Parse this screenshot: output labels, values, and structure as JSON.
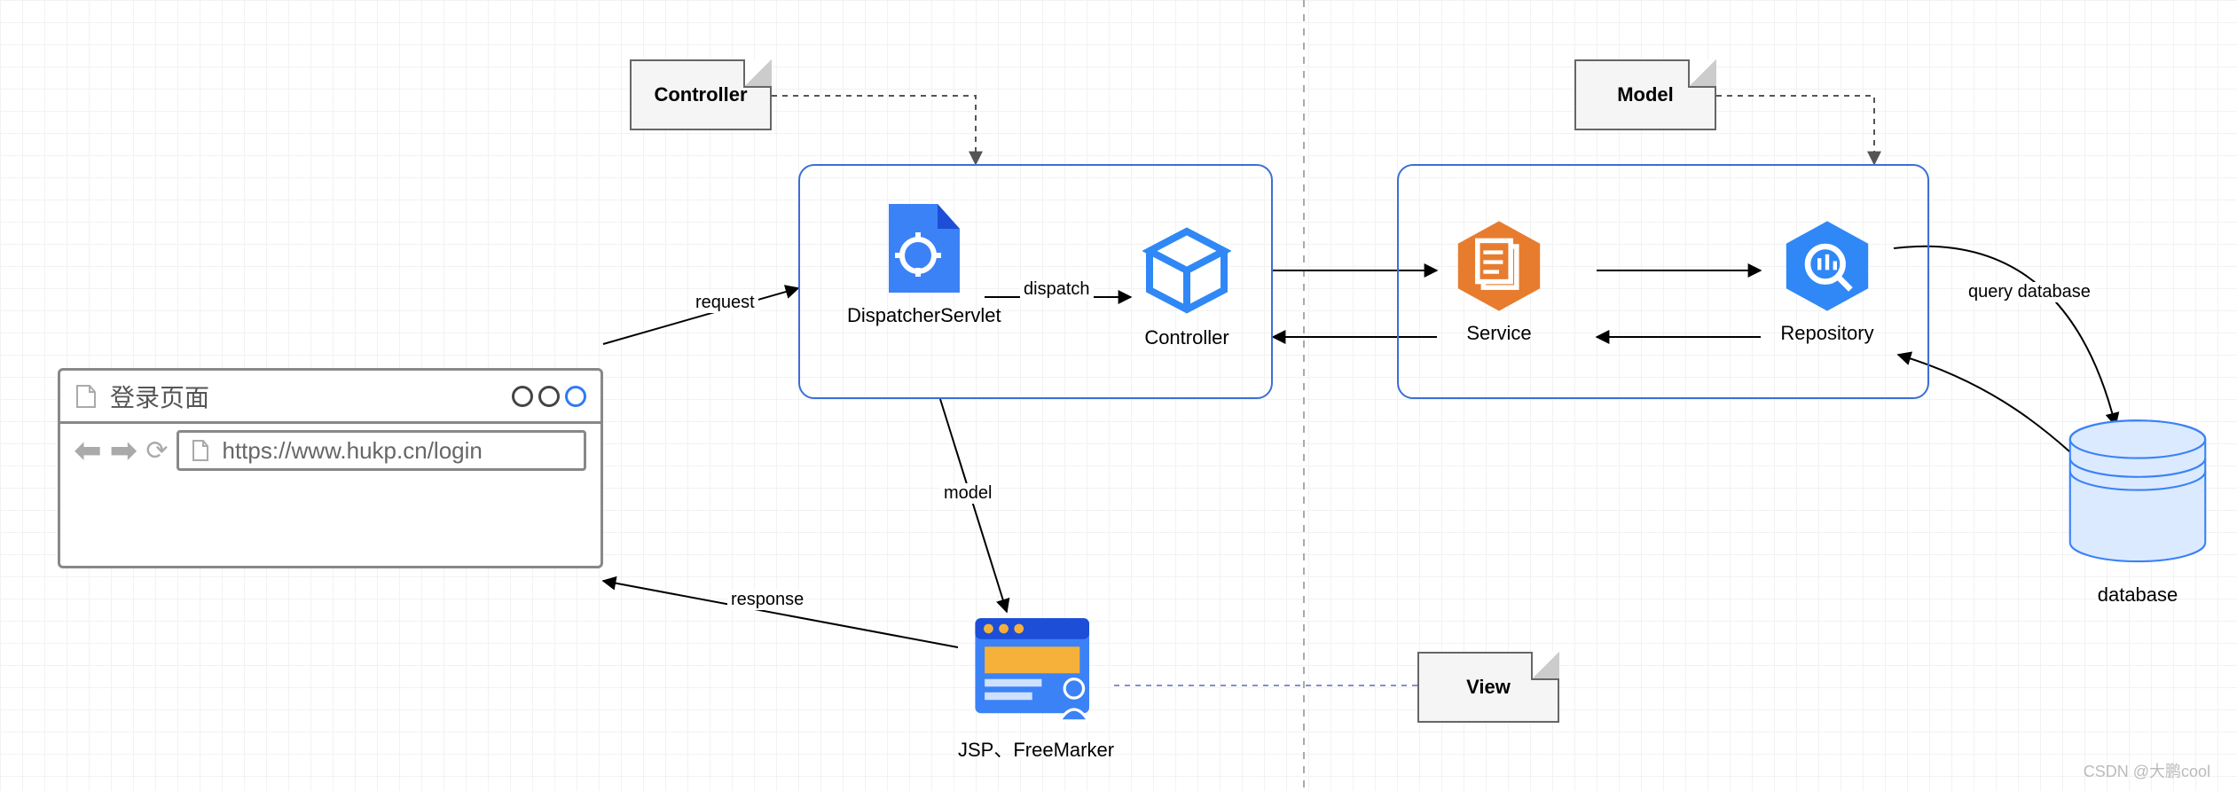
{
  "notes": {
    "controller": "Controller",
    "model": "Model",
    "view": "View"
  },
  "browser": {
    "tab_title": "登录页面",
    "url": "https://www.hukp.cn/login"
  },
  "components": {
    "dispatcher": "DispatcherServlet",
    "controller": "Controller",
    "service": "Service",
    "repository": "Repository",
    "template": "JSP、FreeMarker",
    "database": "database"
  },
  "edges": {
    "request": "request",
    "dispatch": "dispatch",
    "model": "model",
    "response": "response",
    "query_db": "query database"
  },
  "watermark": "CSDN @大鹏cool"
}
